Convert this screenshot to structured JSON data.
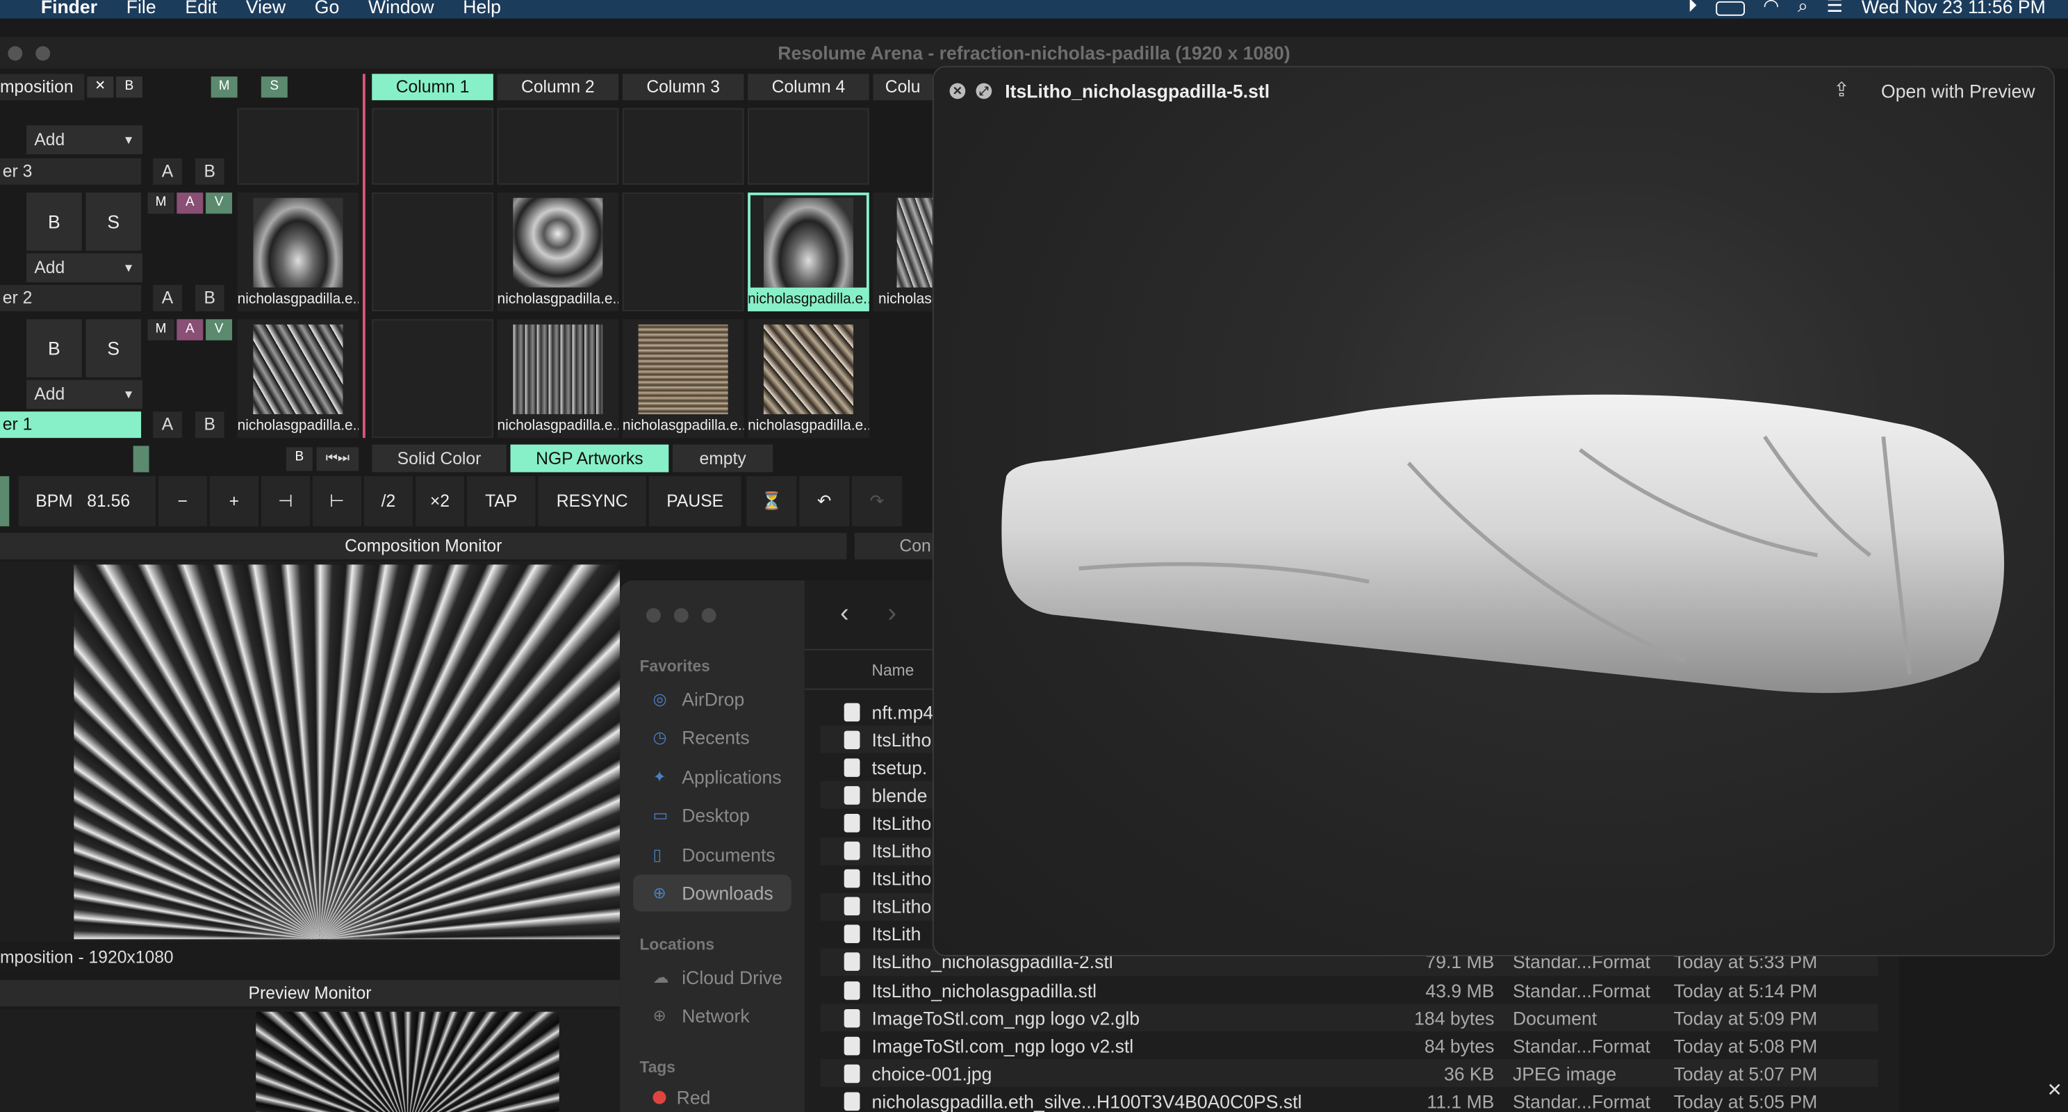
{
  "menubar": {
    "app": "Finder",
    "items": [
      "File",
      "Edit",
      "View",
      "Go",
      "Window",
      "Help"
    ],
    "datetime": "Wed Nov 23  11:56 PM"
  },
  "resolume": {
    "title": "Resolume Arena - refraction-nicholas-padilla (1920 x 1080)",
    "composition_label": "mposition",
    "comp_buttons": [
      "✕",
      "B",
      "M",
      "S"
    ],
    "columns": [
      "Column 1",
      "Column 2",
      "Column 3",
      "Column 4",
      "Colu"
    ],
    "layers": [
      {
        "label": "er 3",
        "add": "Add",
        "ab": [
          "A",
          "B"
        ]
      },
      {
        "label": "er 2",
        "add": "Add",
        "b": "B",
        "s": "S",
        "mav": [
          "M",
          "A",
          "V"
        ],
        "ab": [
          "A",
          "B"
        ],
        "clips": [
          "nicholasgpadilla.e...",
          "",
          "nicholasgpadilla.e...",
          "",
          "nicholasgpadilla.e...",
          "nicholasg"
        ]
      },
      {
        "label": "er 1",
        "add": "Add",
        "b": "B",
        "s": "S",
        "mav": [
          "M",
          "A",
          "V"
        ],
        "ab": [
          "A",
          "B"
        ],
        "clips": [
          "nicholasgpadilla.e...",
          "",
          "nicholasgpadilla.e...",
          "nicholasgpadilla.e...",
          "nicholasgpadilla.e..."
        ]
      }
    ],
    "deck_b": "B",
    "decks": [
      "Solid Color",
      "NGP Artworks",
      "empty"
    ],
    "bpm_label": "BPM",
    "bpm_value": "81.56",
    "transport": [
      "−",
      "+",
      "/2",
      "×2",
      "TAP",
      "RESYNC",
      "PAUSE"
    ],
    "composition_monitor": "Composition Monitor",
    "comp_monitor_right": "Con",
    "comp_status": "mposition - 1920x1080",
    "preview_monitor": "Preview Monitor"
  },
  "finder": {
    "favorites_title": "Favorites",
    "favorites": [
      {
        "label": "AirDrop",
        "icon": "airdrop-icon",
        "glyph": "◎"
      },
      {
        "label": "Recents",
        "icon": "clock-icon",
        "glyph": "◷"
      },
      {
        "label": "Applications",
        "icon": "applications-icon",
        "glyph": "✦"
      },
      {
        "label": "Desktop",
        "icon": "desktop-icon",
        "glyph": "▭"
      },
      {
        "label": "Documents",
        "icon": "document-icon",
        "glyph": "▯"
      },
      {
        "label": "Downloads",
        "icon": "download-icon",
        "glyph": "⊕"
      }
    ],
    "locations_title": "Locations",
    "locations": [
      {
        "label": "iCloud Drive",
        "icon": "cloud-icon",
        "glyph": "☁"
      },
      {
        "label": "Network",
        "icon": "globe-icon",
        "glyph": "⊕"
      }
    ],
    "tags_title": "Tags",
    "tags": [
      {
        "label": "Red",
        "color": "#e0443e"
      }
    ],
    "column_name": "Name",
    "files": [
      {
        "name": "nft.mp4",
        "size": "",
        "kind": "",
        "date": ""
      },
      {
        "name": "ItsLitho",
        "size": "",
        "kind": "",
        "date": ""
      },
      {
        "name": "tsetup.",
        "size": "",
        "kind": "",
        "date": ""
      },
      {
        "name": "blende",
        "size": "",
        "kind": "",
        "date": ""
      },
      {
        "name": "ItsLitho",
        "size": "",
        "kind": "",
        "date": ""
      },
      {
        "name": "ItsLitho",
        "size": "",
        "kind": "",
        "date": ""
      },
      {
        "name": "ItsLitho",
        "size": "",
        "kind": "",
        "date": ""
      },
      {
        "name": "ItsLitho",
        "size": "",
        "kind": "",
        "date": ""
      },
      {
        "name": "ItsLith",
        "size": "",
        "kind": "",
        "date": ""
      },
      {
        "name": "ItsLitho_nicholasgpadilla-2.stl",
        "size": "79.1 MB",
        "kind": "Standar...Format",
        "date": "Today at 5:33 PM"
      },
      {
        "name": "ItsLitho_nicholasgpadilla.stl",
        "size": "43.9 MB",
        "kind": "Standar...Format",
        "date": "Today at 5:14 PM"
      },
      {
        "name": "ImageToStl.com_ngp logo v2.glb",
        "size": "184 bytes",
        "kind": "Document",
        "date": "Today at 5:09 PM"
      },
      {
        "name": "ImageToStl.com_ngp logo v2.stl",
        "size": "84 bytes",
        "kind": "Standar...Format",
        "date": "Today at 5:08 PM"
      },
      {
        "name": "choice-001.jpg",
        "size": "36 KB",
        "kind": "JPEG image",
        "date": "Today at 5:07 PM"
      },
      {
        "name": "nicholasgpadilla.eth_silve...H100T3V4B0A0C0PS.stl",
        "size": "11.1 MB",
        "kind": "Standar...Format",
        "date": "Today at 5:05 PM"
      }
    ]
  },
  "quicklook": {
    "filename": "ItsLitho_nicholasgpadilla-5.stl",
    "open_with": "Open with Preview"
  }
}
